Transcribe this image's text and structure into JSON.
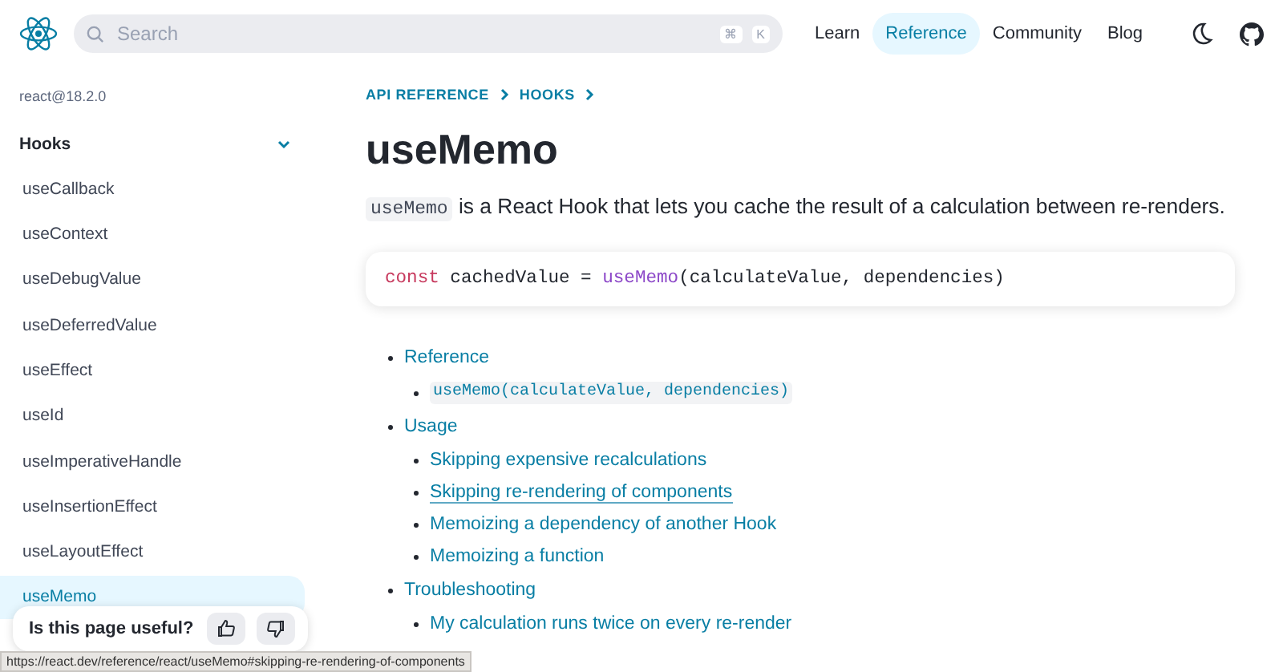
{
  "header": {
    "search": {
      "placeholder": "Search",
      "keys": [
        "⌘",
        "K"
      ]
    },
    "nav": [
      {
        "label": "Learn",
        "selected": false
      },
      {
        "label": "Reference",
        "selected": true
      },
      {
        "label": "Community",
        "selected": false
      },
      {
        "label": "Blog",
        "selected": false
      }
    ]
  },
  "sidebar": {
    "version": "react@18.2.0",
    "section": {
      "label": "Hooks",
      "expanded": true
    },
    "items": [
      {
        "label": "useCallback",
        "selected": false
      },
      {
        "label": "useContext",
        "selected": false
      },
      {
        "label": "useDebugValue",
        "selected": false
      },
      {
        "label": "useDeferredValue",
        "selected": false
      },
      {
        "label": "useEffect",
        "selected": false
      },
      {
        "label": "useId",
        "selected": false
      },
      {
        "label": "useImperativeHandle",
        "selected": false
      },
      {
        "label": "useInsertionEffect",
        "selected": false
      },
      {
        "label": "useLayoutEffect",
        "selected": false
      },
      {
        "label": "useMemo",
        "selected": true
      }
    ]
  },
  "feedback": {
    "question": "Is this page useful?"
  },
  "breadcrumbs": [
    "API REFERENCE",
    "HOOKS"
  ],
  "title": "useMemo",
  "intro": {
    "code": "useMemo",
    "text": "is a React Hook that lets you cache the result of a calculation between re-renders."
  },
  "code_block": [
    {
      "kind": "keyword",
      "text": "const"
    },
    {
      "kind": "plain",
      "text": " cachedValue = "
    },
    {
      "kind": "function",
      "text": "useMemo"
    },
    {
      "kind": "plain",
      "text": "(calculateValue, dependencies)"
    }
  ],
  "toc": [
    {
      "label": "Reference",
      "kind": "link",
      "hovered": false,
      "children": [
        {
          "label": "useMemo(calculateValue, dependencies)",
          "kind": "code",
          "hovered": false
        }
      ]
    },
    {
      "label": "Usage",
      "kind": "link",
      "hovered": false,
      "children": [
        {
          "label": "Skipping expensive recalculations",
          "kind": "link",
          "hovered": false
        },
        {
          "label": "Skipping re-rendering of components",
          "kind": "link",
          "hovered": true
        },
        {
          "label": "Memoizing a dependency of another Hook",
          "kind": "link",
          "hovered": false
        },
        {
          "label": "Memoizing a function",
          "kind": "link",
          "hovered": false
        }
      ]
    },
    {
      "label": "Troubleshooting",
      "kind": "link",
      "hovered": false,
      "children": [
        {
          "label": "My calculation runs twice on every re-render",
          "kind": "link",
          "hovered": false
        }
      ]
    }
  ],
  "status_bar": "https://react.dev/reference/react/useMemo#skipping-re-rendering-of-components"
}
